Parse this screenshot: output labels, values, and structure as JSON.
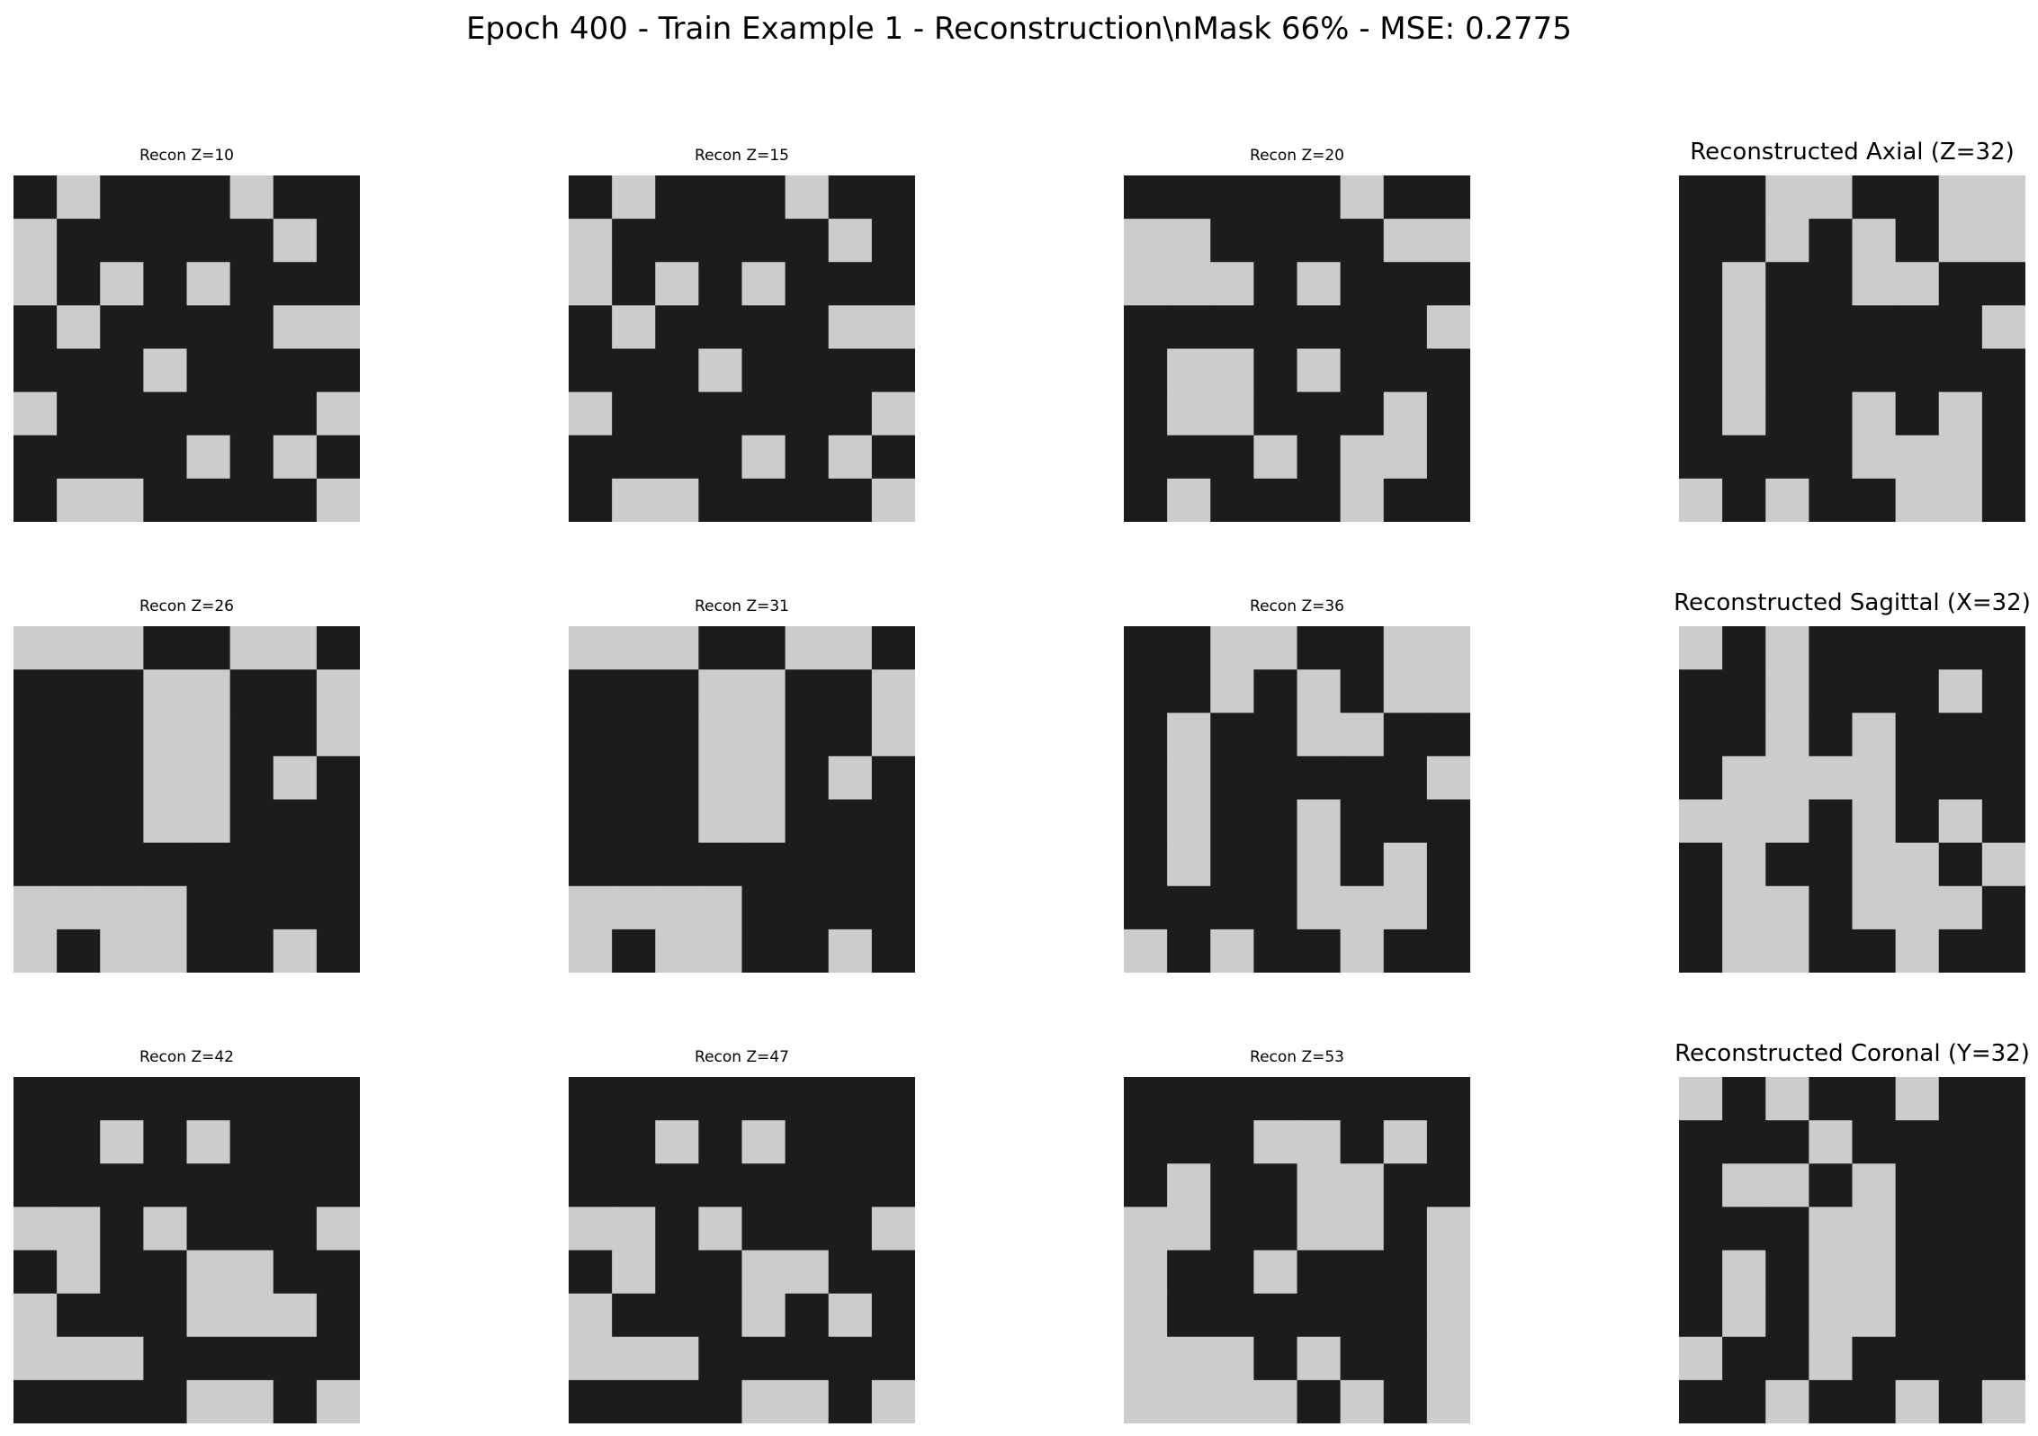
{
  "figure": {
    "suptitle": "Epoch 400 - Train Example 1 - Reconstruction\\nMask 66% - MSE: 0.2775"
  },
  "colors": {
    "dark": "#1c1c1c",
    "light": "#cccccc",
    "background": "#ffffff"
  },
  "chart_data": [
    {
      "type": "heatmap",
      "title": "Recon Z=10",
      "grid": [
        "01000100",
        "10000010",
        "10101000",
        "01000011",
        "00010000",
        "10000001",
        "00001010",
        "01100001"
      ]
    },
    {
      "type": "heatmap",
      "title": "Recon Z=15",
      "grid": [
        "01000100",
        "10000010",
        "10101000",
        "01000011",
        "00010000",
        "10000001",
        "00001010",
        "01100001"
      ]
    },
    {
      "type": "heatmap",
      "title": "Recon Z=20",
      "grid": [
        "00000100",
        "11000011",
        "11101000",
        "00000001",
        "01101000",
        "01100010",
        "00010110",
        "01000100"
      ]
    },
    {
      "type": "heatmap",
      "title": "Reconstructed Axial (Z=32)",
      "grid": [
        "00110011",
        "00101011",
        "01001100",
        "01000001",
        "01000000",
        "01001010",
        "00001110",
        "10100110"
      ]
    },
    {
      "type": "heatmap",
      "title": "Recon Z=26",
      "grid": [
        "11100110",
        "00011001",
        "00011001",
        "00011010",
        "00011000",
        "00000000",
        "11110000",
        "10110010"
      ]
    },
    {
      "type": "heatmap",
      "title": "Recon Z=31",
      "grid": [
        "11100110",
        "00011001",
        "00011001",
        "00011010",
        "00011000",
        "00000000",
        "11110000",
        "10110010"
      ]
    },
    {
      "type": "heatmap",
      "title": "Recon Z=36",
      "grid": [
        "00110011",
        "00101011",
        "01001100",
        "01000001",
        "01001000",
        "01001010",
        "00001110",
        "10100100"
      ]
    },
    {
      "type": "heatmap",
      "title": "Reconstructed Sagittal (X=32)",
      "grid": [
        "10100000",
        "00100010",
        "00101000",
        "01111000",
        "11101010",
        "01001101",
        "01101110",
        "01100100"
      ]
    },
    {
      "type": "heatmap",
      "title": "Recon Z=42",
      "grid": [
        "00000000",
        "00101000",
        "00000000",
        "11010001",
        "01001100",
        "10001110",
        "11100000",
        "00001101"
      ]
    },
    {
      "type": "heatmap",
      "title": "Recon Z=47",
      "grid": [
        "00000000",
        "00101000",
        "00000000",
        "11010001",
        "01001100",
        "10001010",
        "11100000",
        "00001101"
      ]
    },
    {
      "type": "heatmap",
      "title": "Recon Z=53",
      "grid": [
        "00000000",
        "00011010",
        "01001100",
        "11001101",
        "10010001",
        "10000001",
        "11101001",
        "11110101"
      ]
    },
    {
      "type": "heatmap",
      "title": "Reconstructed Coronal (Y=32)",
      "grid": [
        "10100100",
        "00010000",
        "01101000",
        "00011000",
        "01011000",
        "01011000",
        "10010000",
        "00100101"
      ]
    }
  ]
}
